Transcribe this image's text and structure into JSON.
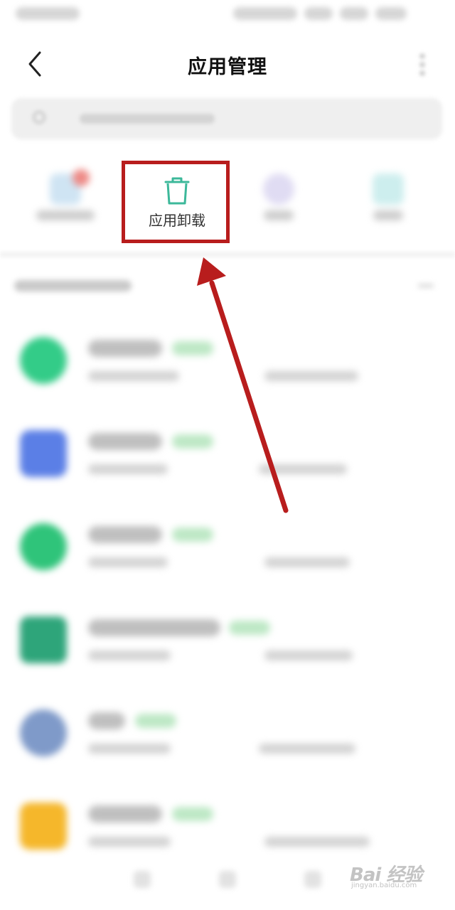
{
  "header": {
    "title": "应用管理"
  },
  "quick_actions": {
    "uninstall_label": "应用卸载"
  },
  "watermark": {
    "brand": "Bai 经验",
    "sub": "jingyan.baidu.com"
  },
  "colors": {
    "annotation_red": "#b81d1d",
    "uninstall_icon": "#3cb89a",
    "tag_green": "#bde8c5"
  },
  "icons": {
    "back": "chevron-left-icon",
    "uninstall": "trash-icon",
    "more": "more-vertical-icon",
    "search": "search-icon"
  }
}
